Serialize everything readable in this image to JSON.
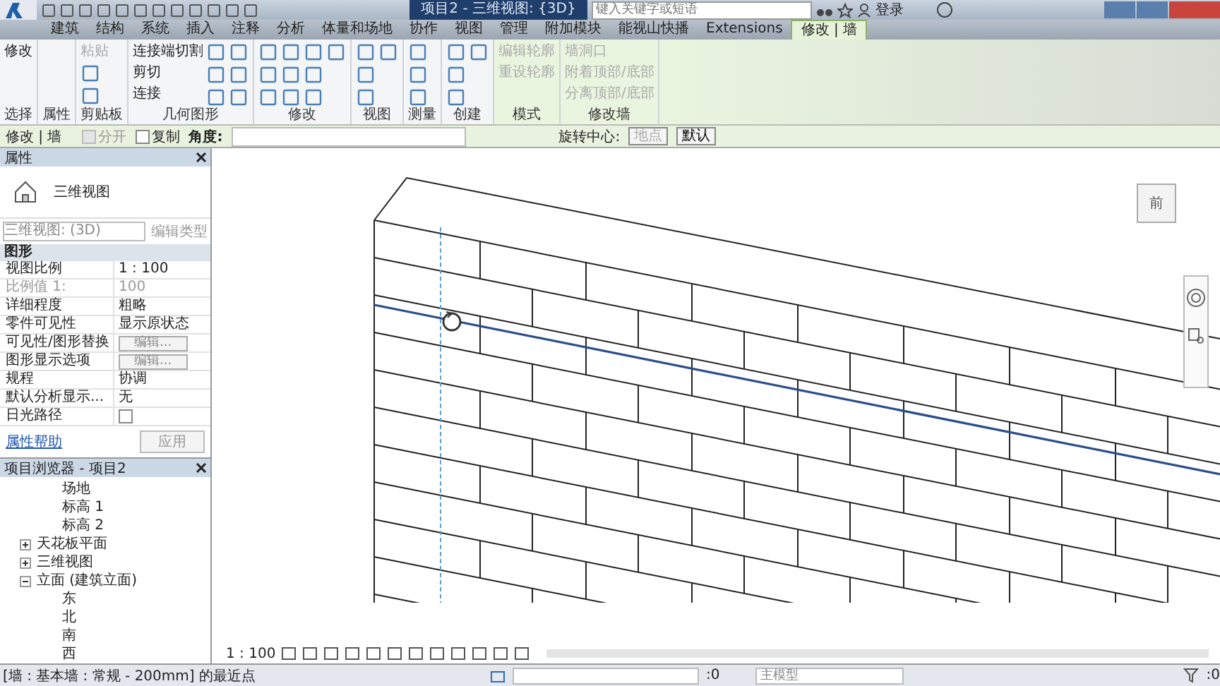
{
  "window": {
    "title": "项目2 - 三维视图: {3D}"
  },
  "search": {
    "placeholder": "键入关键字或短语"
  },
  "sign_in": "登录",
  "ribbon_tabs": [
    {
      "label": "建筑",
      "selected": false
    },
    {
      "label": "结构",
      "selected": false
    },
    {
      "label": "系统",
      "selected": false
    },
    {
      "label": "插入",
      "selected": false
    },
    {
      "label": "注释",
      "selected": false
    },
    {
      "label": "分析",
      "selected": false
    },
    {
      "label": "体量和场地",
      "selected": false
    },
    {
      "label": "协作",
      "selected": false
    },
    {
      "label": "视图",
      "selected": false
    },
    {
      "label": "管理",
      "selected": false
    },
    {
      "label": "附加模块",
      "selected": false
    },
    {
      "label": "能视山快播",
      "selected": false
    },
    {
      "label": "Extensions",
      "selected": false
    },
    {
      "label": "修改 | 墙",
      "selected": true
    }
  ],
  "ribbon_panels": [
    {
      "label": "选择",
      "contextual": false,
      "tools": [
        {
          "label": "修改",
          "disabled": false
        }
      ]
    },
    {
      "label": "属性",
      "contextual": false
    },
    {
      "label": "剪贴板",
      "contextual": false,
      "tools": [
        {
          "label": "粘贴",
          "disabled": true
        }
      ]
    },
    {
      "label": "几何图形",
      "contextual": false,
      "tools": [
        {
          "label": "连接端切割",
          "disabled": false
        },
        {
          "label": "剪切",
          "disabled": false
        },
        {
          "label": "连接",
          "disabled": false
        }
      ]
    },
    {
      "label": "修改",
      "contextual": false
    },
    {
      "label": "视图",
      "contextual": false
    },
    {
      "label": "测量",
      "contextual": false
    },
    {
      "label": "创建",
      "contextual": false
    },
    {
      "label": "模式",
      "contextual": true,
      "tools": [
        {
          "label": "编辑轮廓",
          "disabled": true
        },
        {
          "label": "重设轮廓",
          "disabled": true
        }
      ]
    },
    {
      "label": "修改墙",
      "contextual": true,
      "tools": [
        {
          "label": "墙洞口",
          "disabled": true
        },
        {
          "label": "附着顶部/底部",
          "disabled": true
        },
        {
          "label": "分离顶部/底部",
          "disabled": true
        }
      ]
    }
  ],
  "options_bar": {
    "context": "修改 | 墙",
    "checkboxes": [
      {
        "label": "分开",
        "checked": false,
        "disabled": true
      },
      {
        "label": "复制",
        "checked": false,
        "disabled": false
      }
    ],
    "angle_label": "角度:",
    "rotate_center_label": "旋转中心:",
    "place_button": "地点",
    "default_button": "默认"
  },
  "properties": {
    "title": "属性",
    "type_name": "三维视图",
    "type_selector": "三维视图: (3D)",
    "edit_type": "编辑类型",
    "group": "图形",
    "rows": [
      {
        "kind": "text",
        "name": "视图比例",
        "value": "1 : 100",
        "disabled": false
      },
      {
        "kind": "text",
        "name": "比例值 1:",
        "value": "100",
        "disabled": true
      },
      {
        "kind": "text",
        "name": "详细程度",
        "value": "粗略",
        "disabled": false
      },
      {
        "kind": "text",
        "name": "零件可见性",
        "value": "显示原状态",
        "disabled": false
      },
      {
        "kind": "button",
        "name": "可见性/图形替换",
        "value": "编辑...",
        "disabled": false
      },
      {
        "kind": "button",
        "name": "图形显示选项",
        "value": "编辑...",
        "disabled": false
      },
      {
        "kind": "text",
        "name": "规程",
        "value": "协调",
        "disabled": false
      },
      {
        "kind": "text",
        "name": "默认分析显示...",
        "value": "无",
        "disabled": false
      },
      {
        "kind": "checkbox",
        "name": "日光路径",
        "checked": false,
        "disabled": false
      }
    ],
    "help": "属性帮助",
    "apply": "应用"
  },
  "browser": {
    "title": "项目浏览器 - 项目2",
    "tree": [
      {
        "children": [
          {
            "label": "场地"
          },
          {
            "label": "标高 1"
          },
          {
            "label": "标高 2"
          }
        ]
      },
      {
        "label": "天花板平面",
        "expanded": false
      },
      {
        "label": "三维视图",
        "expanded": false
      },
      {
        "label": "立面 (建筑立面)",
        "expanded": true,
        "children": [
          {
            "label": "东"
          },
          {
            "label": "北"
          },
          {
            "label": "南"
          },
          {
            "label": "西"
          }
        ]
      }
    ]
  },
  "viewcube": {
    "face": "前"
  },
  "view_bar": {
    "scale": "1 : 100"
  },
  "status_bar": {
    "message": "[墙 : 基本墙 : 常规 - 200mm] 的最近点",
    "workset_count": ":0",
    "model": "主模型",
    "filter_count": ":0"
  }
}
